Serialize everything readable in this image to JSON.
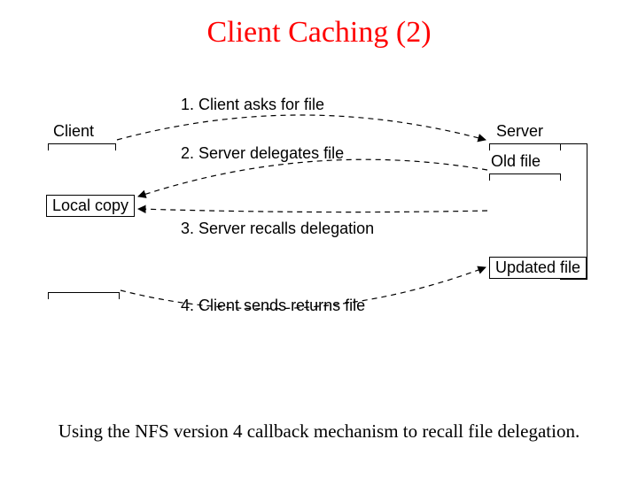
{
  "title": "Client Caching (2)",
  "caption": "Using the NFS version 4 callback mechanism to recall file delegation.",
  "client_label": "Client",
  "server_label": "Server",
  "old_file_label": "Old file",
  "updated_file_label": "Updated file",
  "local_copy_label": "Local copy",
  "step1": "1. Client asks for file",
  "step2": "2. Server delegates file",
  "step3": "3. Server recalls delegation",
  "step4": "4. Client sends returns file"
}
